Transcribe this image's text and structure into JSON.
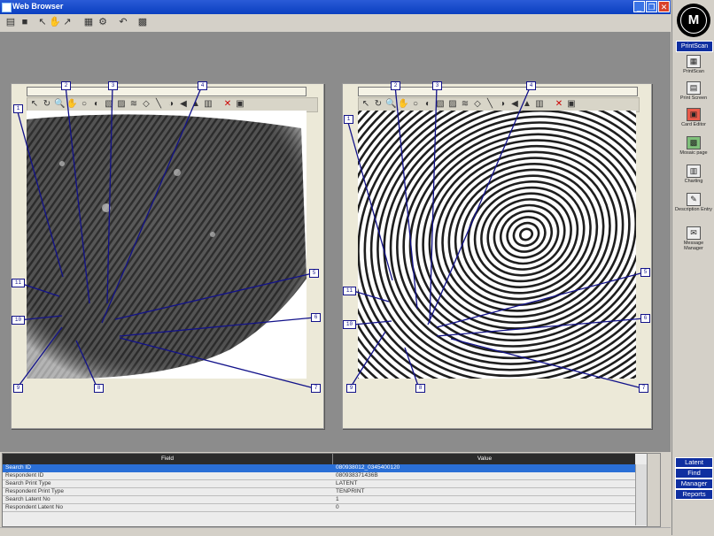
{
  "window": {
    "title": "Web Browser",
    "buttons": [
      "_",
      "❐",
      "✕"
    ]
  },
  "toolbar": {
    "icons": [
      "open-icon",
      "save-icon",
      "pointer-icon",
      "pan-icon",
      "measure-icon",
      "enhance-icon",
      "settings-icon",
      "undo-icon",
      "grid-icon"
    ]
  },
  "sidebar": {
    "title": "PrintScan",
    "items": [
      {
        "label": "PrintScan",
        "icon": "printscan-icon"
      },
      {
        "label": "Print Screen",
        "icon": "print-screen-icon"
      },
      {
        "label": "Card Editor",
        "icon": "card-editor-icon"
      },
      {
        "label": "Mosaic page",
        "icon": "mosaic-page-icon"
      },
      {
        "label": "Charting",
        "icon": "charting-icon"
      },
      {
        "label": "Description Entry",
        "icon": "description-entry-icon"
      },
      {
        "label": "Message Manager",
        "icon": "message-manager-icon"
      }
    ],
    "bottom_nav": [
      "Latent",
      "Find",
      "Manager",
      "Reports"
    ]
  },
  "panels": {
    "left": {
      "labels": [
        "1",
        "2",
        "3",
        "4",
        "5",
        "6",
        "7",
        "8",
        "9",
        "10",
        "11",
        "12"
      ]
    },
    "right": {
      "labels": [
        "1",
        "2",
        "3",
        "4",
        "5",
        "6",
        "7",
        "8",
        "9",
        "10",
        "11",
        "12"
      ]
    }
  },
  "grid": {
    "columns": [
      "Field",
      "Value"
    ],
    "rows": [
      {
        "field": "Search ID",
        "value": "080938012_0345400120"
      },
      {
        "field": "Respondent ID",
        "value": "080938371436B"
      },
      {
        "field": "Search Print Type",
        "value": "LATENT"
      },
      {
        "field": "Respondent Print Type",
        "value": "TENPRINT"
      },
      {
        "field": "Search Latent No",
        "value": "1"
      },
      {
        "field": "Respondent Latent No",
        "value": "0"
      }
    ]
  },
  "colors": {
    "accent": "#0f2fa0",
    "marker_line": "#12128a",
    "selected_row": "#2a6fd6"
  }
}
